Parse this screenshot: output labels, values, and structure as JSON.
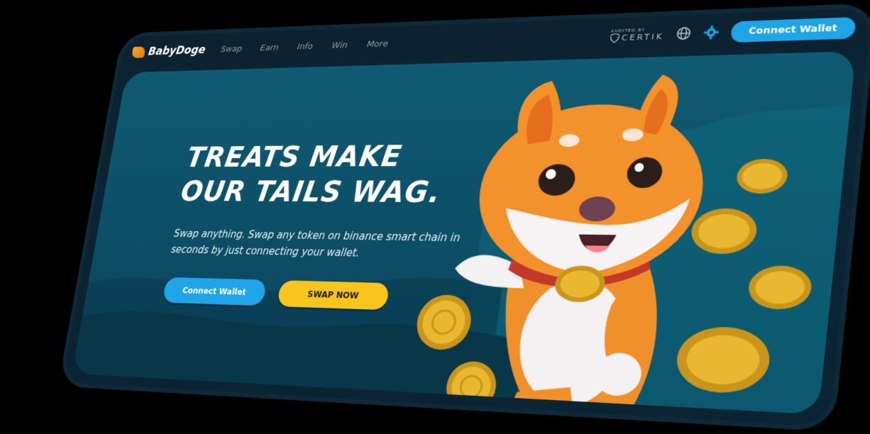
{
  "brand": {
    "name": "BabyDoge"
  },
  "nav": {
    "links": [
      "Swap",
      "Earn",
      "Info",
      "Win",
      "More"
    ],
    "audited_label": "AUDITED BY",
    "auditor": "CERTIK",
    "connect_label": "Connect Wallet"
  },
  "icons": {
    "logo": "babydoge-logo-icon",
    "globe": "globe-icon",
    "settings": "gear-icon",
    "certik": "certik-shield-icon"
  },
  "hero": {
    "headline_line1": "TREATS MAKE",
    "headline_line2": "OUR TAILS WAG.",
    "subtext": "Swap anything. Swap any token on binance smart chain in seconds by just connecting your wallet.",
    "connect_label": "Connect Wallet",
    "swap_label": "SWAP NOW"
  },
  "colors": {
    "accent_blue": "#1fa4e8",
    "accent_yellow": "#f7c51c",
    "hero_bg": "#0f5b73",
    "nav_bg": "#0d2230"
  }
}
